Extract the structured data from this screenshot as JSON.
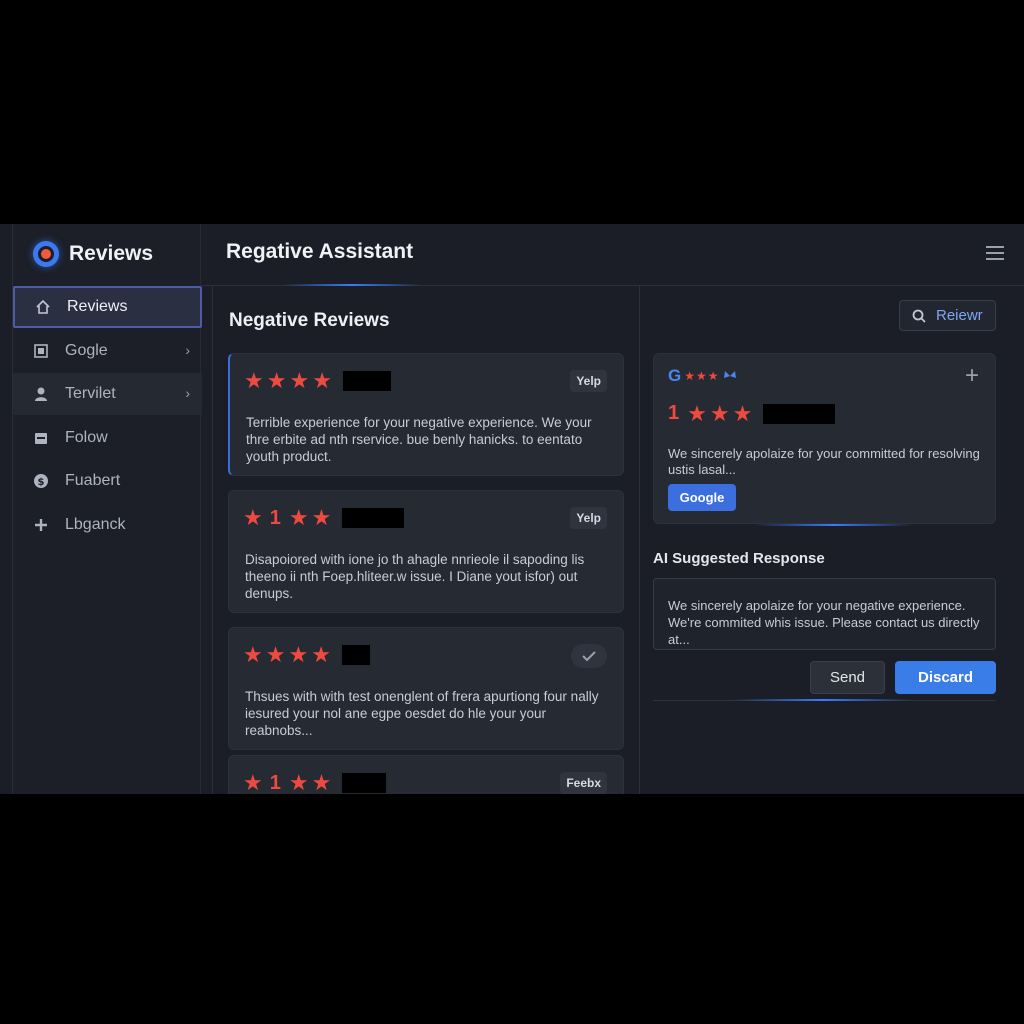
{
  "colors": {
    "accent": "#3b7de8",
    "star": "#ef4a40",
    "background": "#1b1e26"
  },
  "sidebar": {
    "brand_title": "Reviews",
    "items": [
      {
        "label": "Reviews",
        "icon": "home-icon"
      },
      {
        "label": "Gogle",
        "icon": "square-icon"
      },
      {
        "label": "Tervilet",
        "icon": "user-icon"
      },
      {
        "label": "Folow",
        "icon": "calendar-icon"
      },
      {
        "label": "Fuabert",
        "icon": "dollar-icon"
      },
      {
        "label": "Lbganck",
        "icon": "plus-icon"
      }
    ]
  },
  "header": {
    "title": "Regative Assistant",
    "menu_icon": "hamburger-icon"
  },
  "main": {
    "section_title": "Negative Reviews",
    "search_button": "Reiewr",
    "reviews": [
      {
        "rating_number": "",
        "source": "Yelp",
        "text": "Terrible experience for your negative experience. We your thre erbite ad nth rservice. bue benly hanicks. to eentato youth product."
      },
      {
        "rating_number": "1",
        "source": "Yelp",
        "text": "Disapoiored with ione jo th ahagle nnrieole il sapoding lis theeno ii nth Foep.hliteer.w issue. I Diane yout isfor) out denups."
      },
      {
        "rating_number": "",
        "source": "verified",
        "text": "Thsues with with test onenglent of frera apurtiong four nally iesured your nol ane egpe oesdet do hle your your reabnobs..."
      },
      {
        "rating_number": "1",
        "source": "Feebx",
        "text": ""
      }
    ],
    "google_card": {
      "logo": "G",
      "rating_number": "1",
      "text": "We sincerely apolaize for your committed for resolving ustis lasal...",
      "button": "Google"
    },
    "ai": {
      "title": "AI Suggested Response",
      "text": "We sincerely apolaize for your negative experience. We're commited whis issue. Please contact us directly at..."
    },
    "send_button": "Send",
    "discard_button": "Discard"
  }
}
